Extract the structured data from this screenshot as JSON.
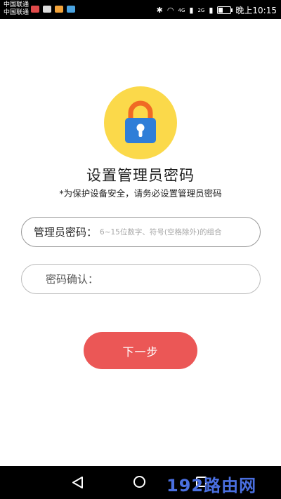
{
  "status_bar": {
    "carrier_line1": "中国联通",
    "carrier_line2": "中国联通",
    "signal_text_1": "4G",
    "signal_text_2": "2G",
    "time": "晚上10:15",
    "battery_level": 0.3
  },
  "header": {
    "title": "设置管理员密码",
    "subtitle": "*为保护设备安全，请务必设置管理员密码"
  },
  "form": {
    "password_label": "管理员密码：",
    "password_placeholder": "6~15位数字、符号(空格除外)的组合",
    "confirm_label": "密码确认：",
    "confirm_placeholder": ""
  },
  "actions": {
    "next_label": "下一步"
  },
  "watermark": "192路由网",
  "colors": {
    "lock_bg": "#fbd94a",
    "lock_shackle": "#f06a24",
    "lock_body": "#2f7ed8",
    "button_bg": "#eb5756"
  }
}
